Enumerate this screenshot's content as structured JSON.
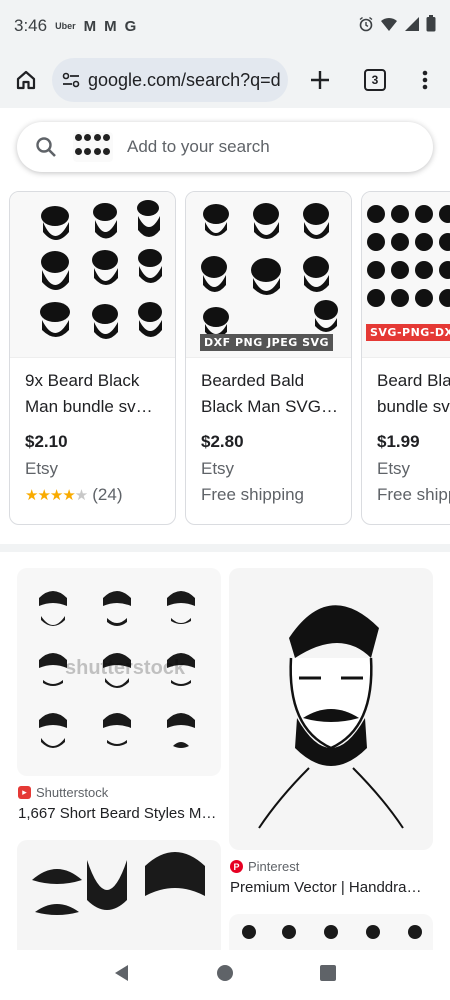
{
  "status_bar": {
    "time": "3:46",
    "notification_1": "Uber",
    "notification_2": "M",
    "notification_3": "M",
    "notification_4": "G"
  },
  "toolbar": {
    "url": "google.com/search?q=d",
    "tab_count": "3"
  },
  "search": {
    "placeholder": "Add to your search"
  },
  "products": [
    {
      "title": "9x Beard Black Man bundle sv…",
      "price": "$2.10",
      "merchant": "Etsy",
      "rating": "★★★★",
      "rating_off": "★",
      "review_count": "(24)",
      "shipping": ""
    },
    {
      "title": "Bearded Bald Black Man SVG…",
      "price": "$2.80",
      "merchant": "Etsy",
      "shipping": "Free shipping",
      "banner": "DXF PNG JPEG SVG"
    },
    {
      "title": "Beard Black Man bundle sv…",
      "price": "$1.99",
      "merchant": "Etsy",
      "shipping": "Free shipping",
      "banner": "SVG-PNG-DXF"
    }
  ],
  "images": [
    {
      "source": "Shutterstock",
      "caption": "1,667 Short Beard Styles M…",
      "watermark": "shutterstock"
    },
    {
      "source": "Pinterest",
      "caption": "Premium Vector | Handdra…"
    }
  ],
  "colors": {
    "chrome_bg": "#f1f3f4",
    "omnibox_bg": "#e3e8ef",
    "star": "#f9ab00",
    "shutterstock": "#e53935",
    "pinterest": "#e60023"
  }
}
